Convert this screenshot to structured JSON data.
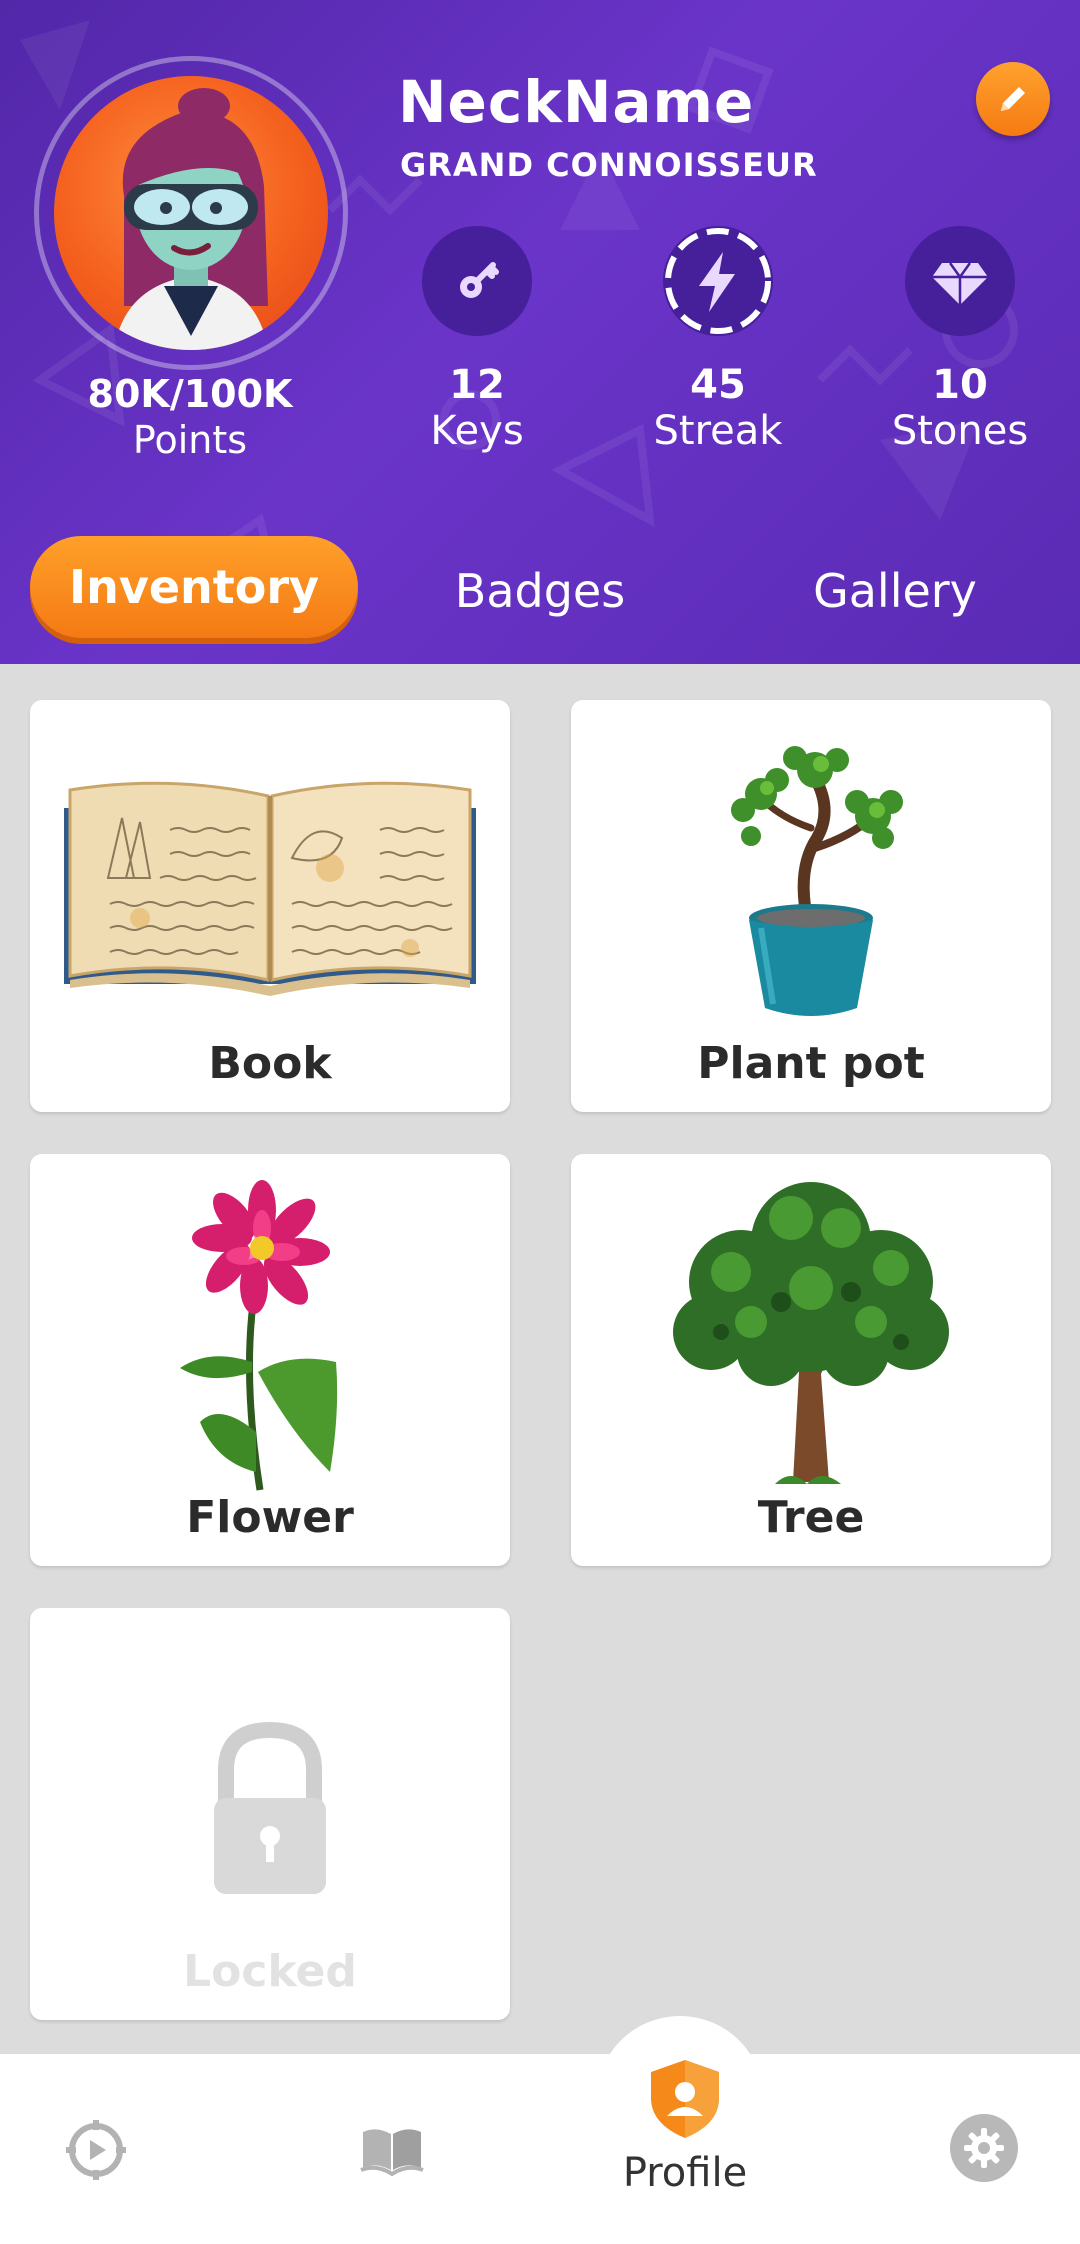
{
  "profile": {
    "name": "NeckName",
    "title": "GRAND CONNOISSEUR",
    "points_value": "80K/100K",
    "points_label": "Points"
  },
  "stats": [
    {
      "value": "12",
      "label": "Keys",
      "icon": "key-icon"
    },
    {
      "value": "45",
      "label": "Streak",
      "icon": "lightning-icon"
    },
    {
      "value": "10",
      "label": "Stones",
      "icon": "gem-icon"
    }
  ],
  "tabs": {
    "active": "Inventory",
    "items": [
      "Inventory",
      "Badges",
      "Gallery"
    ]
  },
  "inventory": [
    {
      "name": "Book",
      "icon": "book-icon"
    },
    {
      "name": "Plant pot",
      "icon": "plant-pot-icon"
    },
    {
      "name": "Flower",
      "icon": "flower-icon"
    },
    {
      "name": "Tree",
      "icon": "tree-icon"
    },
    {
      "name": "Locked",
      "icon": "lock-icon",
      "locked": true
    }
  ],
  "nav": {
    "items": [
      {
        "icon": "target-icon"
      },
      {
        "icon": "open-book-icon"
      },
      {
        "icon": "shield-user-icon",
        "label": "Profile",
        "active": true
      },
      {
        "icon": "gear-icon"
      }
    ]
  },
  "colors": {
    "header_purple": "#5a2bb4",
    "accent_orange": "#f57a12",
    "stat_circle": "#45209a",
    "background": "#dcdcdc"
  }
}
